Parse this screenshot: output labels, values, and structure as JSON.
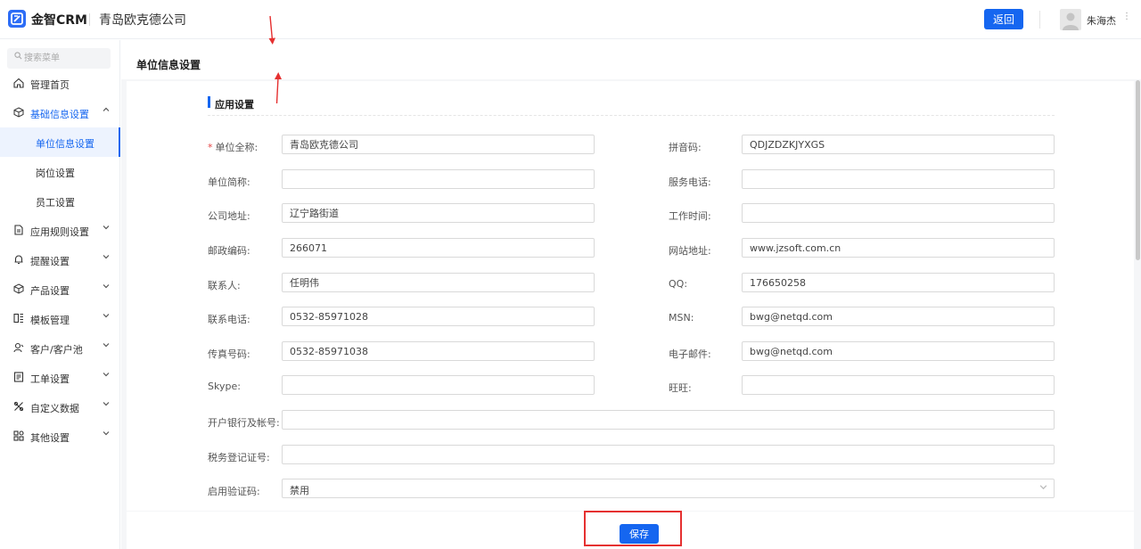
{
  "header": {
    "brand": "金智CRM",
    "company": "青岛欧克德公司",
    "back_label": "返回",
    "user_name": "朱海杰"
  },
  "sidebar": {
    "search_placeholder": "搜索菜单",
    "items": [
      {
        "label": "管理首页",
        "icon": "home-icon"
      },
      {
        "label": "基础信息设置",
        "icon": "cube-icon",
        "expanded": true
      },
      {
        "label": "应用规则设置",
        "icon": "document-icon"
      },
      {
        "label": "提醒设置",
        "icon": "bell-icon"
      },
      {
        "label": "产品设置",
        "icon": "cube-icon"
      },
      {
        "label": "模板管理",
        "icon": "template-icon"
      },
      {
        "label": "客户/客户池",
        "icon": "customer-icon"
      },
      {
        "label": "工单设置",
        "icon": "ticket-icon"
      },
      {
        "label": "自定义数据",
        "icon": "custom-icon"
      },
      {
        "label": "其他设置",
        "icon": "grid-icon"
      }
    ],
    "sub_items": [
      {
        "label": "单位信息设置",
        "selected": true
      },
      {
        "label": "岗位设置"
      },
      {
        "label": "员工设置"
      }
    ]
  },
  "page": {
    "title": "单位信息设置",
    "section_title": "应用设置"
  },
  "form": {
    "unit_full_name": {
      "label": "单位全称:",
      "value": "青岛欧克德公司",
      "required": true
    },
    "pinyin": {
      "label": "拼音码:",
      "value": "QDJZDZKJYXGS"
    },
    "unit_short_name": {
      "label": "单位简称:",
      "value": ""
    },
    "service_phone": {
      "label": "服务电话:",
      "value": ""
    },
    "company_address": {
      "label": "公司地址:",
      "value": "辽宁路街道"
    },
    "work_hours": {
      "label": "工作时间:",
      "value": ""
    },
    "postal_code": {
      "label": "邮政编码:",
      "value": "266071"
    },
    "website": {
      "label": "网站地址:",
      "value": "www.jzsoft.com.cn"
    },
    "contact": {
      "label": "联系人:",
      "value": "任明伟"
    },
    "qq": {
      "label": "QQ:",
      "value": "176650258"
    },
    "contact_phone": {
      "label": "联系电话:",
      "value": "0532-85971028"
    },
    "msn": {
      "label": "MSN:",
      "value": "bwg@netqd.com"
    },
    "fax": {
      "label": "传真号码:",
      "value": "0532-85971038"
    },
    "email": {
      "label": "电子邮件:",
      "value": "bwg@netqd.com"
    },
    "skype": {
      "label": "Skype:",
      "value": ""
    },
    "wangwang": {
      "label": "旺旺:",
      "value": ""
    },
    "bank_account": {
      "label": "开户银行及帐号:",
      "value": ""
    },
    "tax_id": {
      "label": "税务登记证号:",
      "value": ""
    },
    "captcha": {
      "label": "启用验证码:",
      "value": "禁用"
    }
  },
  "footer": {
    "save_label": "保存"
  },
  "colors": {
    "accent": "#1566f0",
    "annotation": "#e53030"
  }
}
